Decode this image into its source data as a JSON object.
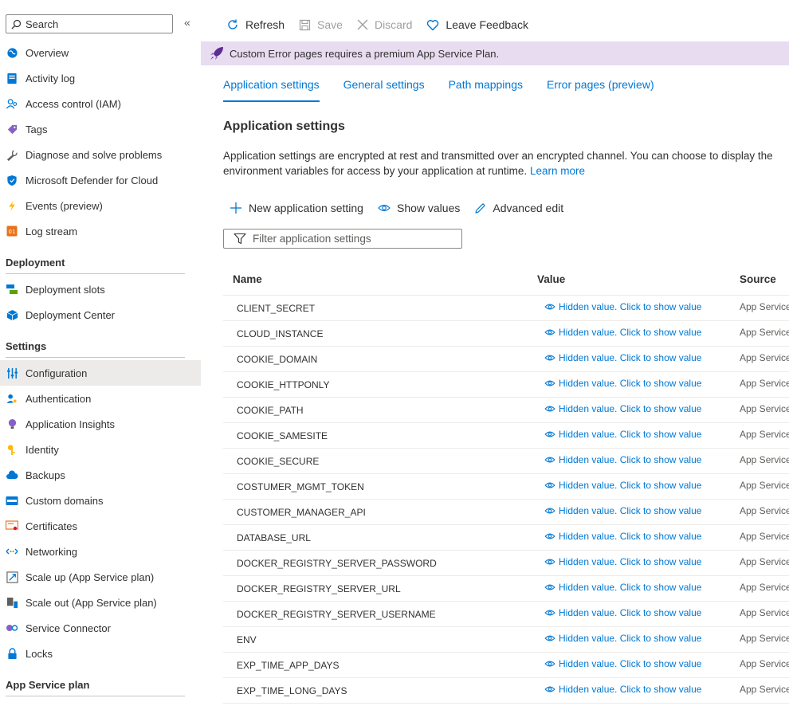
{
  "sidebar": {
    "search_placeholder": "Search",
    "collapse_glyph": "«",
    "items_top": [
      {
        "label": "Overview",
        "icon": "globe-icon",
        "color": "#0078d4"
      },
      {
        "label": "Activity log",
        "icon": "activity-log-icon",
        "color": "#0078d4"
      },
      {
        "label": "Access control (IAM)",
        "icon": "users-icon",
        "color": "#0078d4"
      },
      {
        "label": "Tags",
        "icon": "tag-icon",
        "color": "#8661c5"
      },
      {
        "label": "Diagnose and solve problems",
        "icon": "wrench-icon",
        "color": "#605e5c"
      },
      {
        "label": "Microsoft Defender for Cloud",
        "icon": "shield-icon",
        "color": "#0078d4"
      },
      {
        "label": "Events (preview)",
        "icon": "lightning-icon",
        "color": "#ffb900"
      },
      {
        "label": "Log stream",
        "icon": "log-stream-icon",
        "color": "#e8711a"
      }
    ],
    "deployment": {
      "header": "Deployment",
      "items": [
        {
          "label": "Deployment slots",
          "icon": "slots-icon",
          "color": "#57a300"
        },
        {
          "label": "Deployment Center",
          "icon": "cube-icon",
          "color": "#0078d4"
        }
      ]
    },
    "settings": {
      "header": "Settings",
      "items": [
        {
          "label": "Configuration",
          "icon": "sliders-icon",
          "color": "#0078d4",
          "active": true
        },
        {
          "label": "Authentication",
          "icon": "user-key-icon",
          "color": "#0078d4"
        },
        {
          "label": "Application Insights",
          "icon": "bulb-icon",
          "color": "#8661c5"
        },
        {
          "label": "Identity",
          "icon": "key-icon",
          "color": "#ffb900"
        },
        {
          "label": "Backups",
          "icon": "cloud-icon",
          "color": "#0078d4"
        },
        {
          "label": "Custom domains",
          "icon": "domain-icon",
          "color": "#0078d4"
        },
        {
          "label": "Certificates",
          "icon": "certificate-icon",
          "color": "#e8711a"
        },
        {
          "label": "Networking",
          "icon": "network-icon",
          "color": "#0078d4"
        },
        {
          "label": "Scale up (App Service plan)",
          "icon": "scale-up-icon",
          "color": "#0078d4"
        },
        {
          "label": "Scale out (App Service plan)",
          "icon": "scale-out-icon",
          "color": "#605e5c"
        },
        {
          "label": "Service Connector",
          "icon": "connector-icon",
          "color": "#8661c5"
        },
        {
          "label": "Locks",
          "icon": "lock-icon",
          "color": "#0078d4"
        }
      ]
    },
    "app_service_plan": {
      "header": "App Service plan"
    }
  },
  "toolbar": {
    "refresh": "Refresh",
    "save": "Save",
    "discard": "Discard",
    "feedback": "Leave Feedback"
  },
  "banner": {
    "text": "Custom Error pages requires a premium App Service Plan."
  },
  "tabs": [
    {
      "label": "Application settings",
      "active": true
    },
    {
      "label": "General settings"
    },
    {
      "label": "Path mappings"
    },
    {
      "label": "Error pages (preview)"
    }
  ],
  "main": {
    "title": "Application settings",
    "desc_line1": "Application settings are encrypted at rest and transmitted over an encrypted channel. You can choose to display the",
    "desc_line2": "environment variables for access by your application at runtime.",
    "learn_more": "Learn more",
    "new_setting": "New application setting",
    "show_values": "Show values",
    "advanced_edit": "Advanced edit",
    "filter_placeholder": "Filter application settings"
  },
  "table": {
    "headers": {
      "name": "Name",
      "value": "Value",
      "source": "Source"
    },
    "rows": [
      {
        "name": "CLIENT_SECRET",
        "value": "Hidden value. Click to show value",
        "source": "App Service"
      },
      {
        "name": "CLOUD_INSTANCE",
        "value": "Hidden value. Click to show value",
        "source": "App Service"
      },
      {
        "name": "COOKIE_DOMAIN",
        "value": "Hidden value. Click to show value",
        "source": "App Service"
      },
      {
        "name": "COOKIE_HTTPONLY",
        "value": "Hidden value. Click to show value",
        "source": "App Service"
      },
      {
        "name": "COOKIE_PATH",
        "value": "Hidden value. Click to show value",
        "source": "App Service"
      },
      {
        "name": "COOKIE_SAMESITE",
        "value": "Hidden value. Click to show value",
        "source": "App Service"
      },
      {
        "name": "COOKIE_SECURE",
        "value": "Hidden value. Click to show value",
        "source": "App Service"
      },
      {
        "name": "COSTUMER_MGMT_TOKEN",
        "value": "Hidden value. Click to show value",
        "source": "App Service"
      },
      {
        "name": "CUSTOMER_MANAGER_API",
        "value": "Hidden value. Click to show value",
        "source": "App Service"
      },
      {
        "name": "DATABASE_URL",
        "value": "Hidden value. Click to show value",
        "source": "App Service"
      },
      {
        "name": "DOCKER_REGISTRY_SERVER_PASSWORD",
        "value": "Hidden value. Click to show value",
        "source": "App Service"
      },
      {
        "name": "DOCKER_REGISTRY_SERVER_URL",
        "value": "Hidden value. Click to show value",
        "source": "App Service"
      },
      {
        "name": "DOCKER_REGISTRY_SERVER_USERNAME",
        "value": "Hidden value. Click to show value",
        "source": "App Service"
      },
      {
        "name": "ENV",
        "value": "Hidden value. Click to show value",
        "source": "App Service"
      },
      {
        "name": "EXP_TIME_APP_DAYS",
        "value": "Hidden value. Click to show value",
        "source": "App Service"
      },
      {
        "name": "EXP_TIME_LONG_DAYS",
        "value": "Hidden value. Click to show value",
        "source": "App Service"
      }
    ]
  }
}
